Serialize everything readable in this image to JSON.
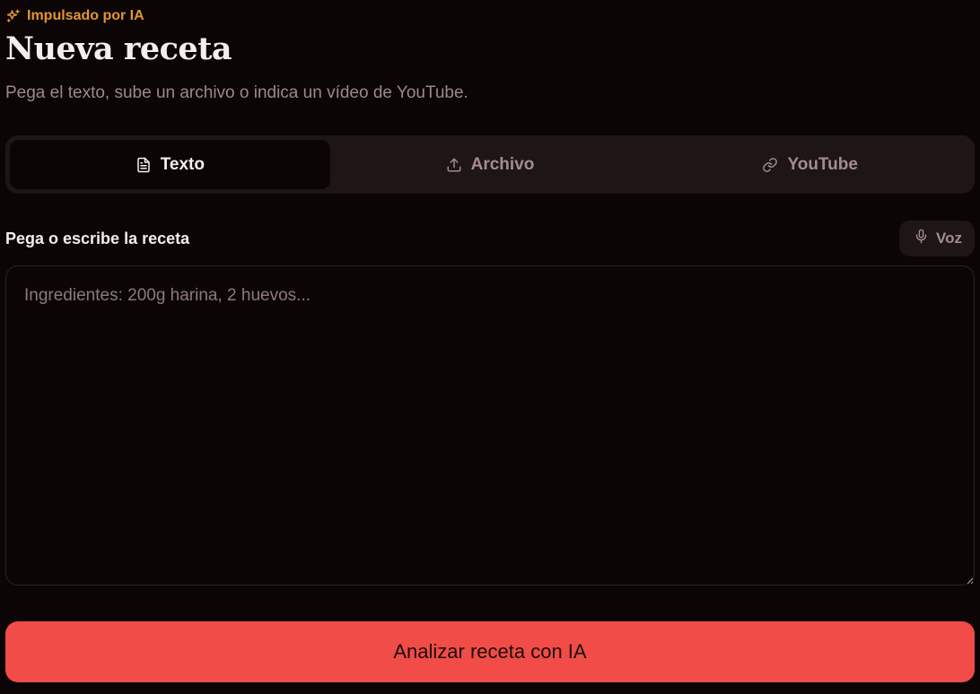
{
  "header": {
    "badge": "Impulsado por IA",
    "badge_icon": "sparkles-icon",
    "title": "Nueva receta",
    "subtitle": "Pega el texto, sube un archivo o indica un vídeo de YouTube."
  },
  "tabs": [
    {
      "label": "Texto",
      "icon": "file-text-icon",
      "active": true
    },
    {
      "label": "Archivo",
      "icon": "upload-icon",
      "active": false
    },
    {
      "label": "YouTube",
      "icon": "link-icon",
      "active": false
    }
  ],
  "editor": {
    "label": "Pega o escribe la receta",
    "voice_label": "Voz",
    "voice_icon": "microphone-icon",
    "value": "",
    "placeholder": "Ingredientes: 200g harina, 2 huevos..."
  },
  "submit": {
    "label": "Analizar receta con IA"
  },
  "colors": {
    "background": "#0b0506",
    "accent": "#f14c47",
    "badge": "#e3952f",
    "tab_bar": "#1d1516"
  }
}
